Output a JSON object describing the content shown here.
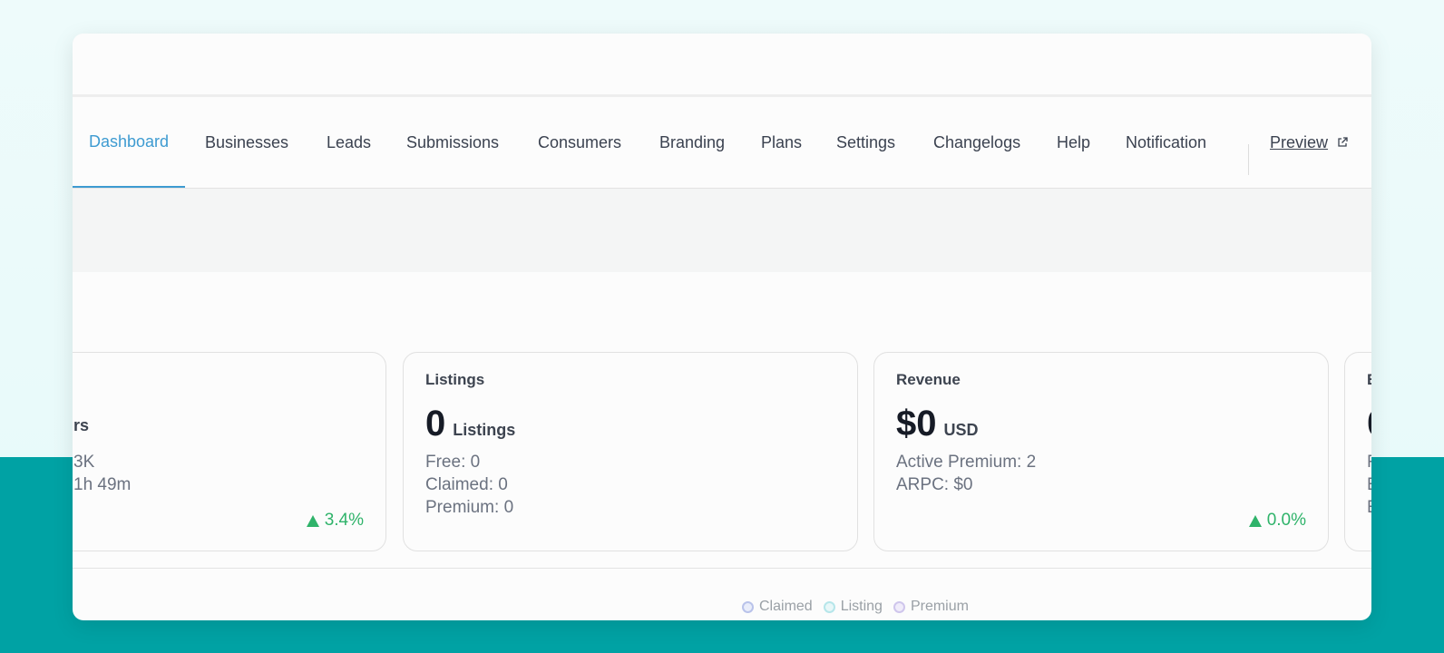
{
  "nav": {
    "items": [
      "Dashboard",
      "Businesses",
      "Leads",
      "Submissions",
      "Consumers",
      "Branding",
      "Plans",
      "Settings",
      "Changelogs",
      "Help",
      "Notification"
    ],
    "active": "Dashboard",
    "preview_label": "Preview"
  },
  "cards": {
    "users": {
      "big_unit": "rs",
      "lines": [
        "3K",
        "1h 49m"
      ],
      "trend": "3.4%"
    },
    "listings": {
      "title": "Listings",
      "big_num": "0",
      "big_unit": "Listings",
      "lines": [
        "Free: 0",
        "Claimed: 0",
        "Premium: 0"
      ]
    },
    "revenue": {
      "title": "Revenue",
      "big_num": "$0",
      "big_unit": "USD",
      "lines": [
        "Active Premium: 2",
        "ARPC: $0"
      ],
      "trend": "0.0%"
    },
    "partial": {
      "title": "E",
      "big_num": "0",
      "lines": [
        "F",
        "E",
        "E"
      ]
    }
  },
  "legend": {
    "items": [
      {
        "label": "Claimed",
        "color": "#b9c3ea",
        "fill": "#e9edfa"
      },
      {
        "label": "Listing",
        "color": "#b6e6ea",
        "fill": "#e8f7f8"
      },
      {
        "label": "Premium",
        "color": "#cfc6ec",
        "fill": "#f0ecfa"
      }
    ]
  },
  "colors": {
    "accent": "#3e9bd1",
    "teal": "#00a2a4",
    "positive": "#2fb36a"
  }
}
